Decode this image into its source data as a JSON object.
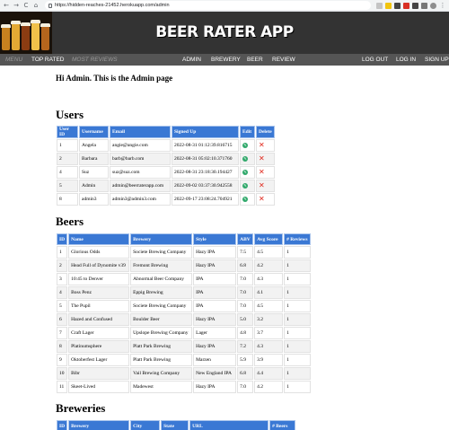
{
  "browser": {
    "back": "←",
    "forward": "→",
    "reload": "C",
    "home": "⌂",
    "url": "https://hidden-reaches-21452.herokuapp.com/admin"
  },
  "app": {
    "title": "BEER RATER APP"
  },
  "nav": {
    "menu": "MENU",
    "top_rated": "TOP RATED",
    "most_reviews": "MOST REVIEWS",
    "admin": "ADMIN",
    "brewery": "BREWERY",
    "beer": "BEER",
    "review": "REVIEW",
    "logout": "LOG OUT",
    "login": "LOG IN",
    "signup": "SIGN UP"
  },
  "greeting": "Hi Admin. This is the Admin page",
  "users": {
    "heading": "Users",
    "columns": [
      "User ID",
      "Username",
      "Email",
      "Signed Up",
      "Edit",
      "Delete"
    ],
    "rows": [
      [
        "1",
        "Angela",
        "angie@angie.com",
        "2022-08-31 01:12:39.816715"
      ],
      [
        "2",
        "Barbara",
        "barb@barb.com",
        "2022-08-31 05:02:10.371760"
      ],
      [
        "4",
        "Suz",
        "suz@suz.com",
        "2022-08-31 23:18:30.194427"
      ],
      [
        "5",
        "Admin",
        "admin@beerraterapp.com",
        "2022-09-02 03:37:30.942558"
      ],
      [
        "8",
        "admin3",
        "admin3@admin3.com",
        "2022-09-17 23:08:24.704921"
      ]
    ]
  },
  "beers": {
    "heading": "Beers",
    "columns": [
      "ID",
      "Name",
      "Brewery",
      "Style",
      "ABV",
      "Avg Score",
      "# Reviews"
    ],
    "rows": [
      [
        "1",
        "Glorious Odds",
        "Societe Brewing Company",
        "Hazy IPA",
        "7.5",
        "4.5",
        "1"
      ],
      [
        "2",
        "Head Full of Dynomite v39",
        "Fremont Brewing",
        "Hazy IPA",
        "6.8",
        "4.2",
        "1"
      ],
      [
        "3",
        "10:45 to Denver",
        "Abnormal Beer Company",
        "IPA",
        "7.0",
        "4.3",
        "1"
      ],
      [
        "4",
        "Boss Penz",
        "Eppig Brewing",
        "IPA",
        "7.0",
        "4.1",
        "1"
      ],
      [
        "5",
        "The Pupil",
        "Societe Brewing Company",
        "IPA",
        "7.0",
        "4.5",
        "1"
      ],
      [
        "6",
        "Hazed and Confused",
        "Boulder Beer",
        "Hazy IPA",
        "5.0",
        "3.2",
        "1"
      ],
      [
        "7",
        "Craft Lager",
        "Upslope Brewing Company",
        "Lager",
        "4.8",
        "3.7",
        "1"
      ],
      [
        "8",
        "Platinumsphere",
        "Platt Park Brewing",
        "Hazy IPA",
        "7.2",
        "4.3",
        "1"
      ],
      [
        "9",
        "Oktoberfest Lager",
        "Platt Park Brewing",
        "Marzen",
        "5.9",
        "3.9",
        "1"
      ],
      [
        "10",
        "Bibr",
        "Vail Brewing Company",
        "New England IPA",
        "6.8",
        "4.4",
        "1"
      ],
      [
        "11",
        "Skeet-Lived",
        "Madewest",
        "Hazy IPA",
        "7.0",
        "4.2",
        "1"
      ]
    ]
  },
  "breweries": {
    "heading": "Breweries",
    "columns": [
      "ID",
      "Brewery",
      "City",
      "State",
      "URL",
      "# Beers"
    ]
  },
  "colors": {
    "header_bg": "#333333",
    "nav_bg": "#555555",
    "table_header": "#3a78d4"
  }
}
